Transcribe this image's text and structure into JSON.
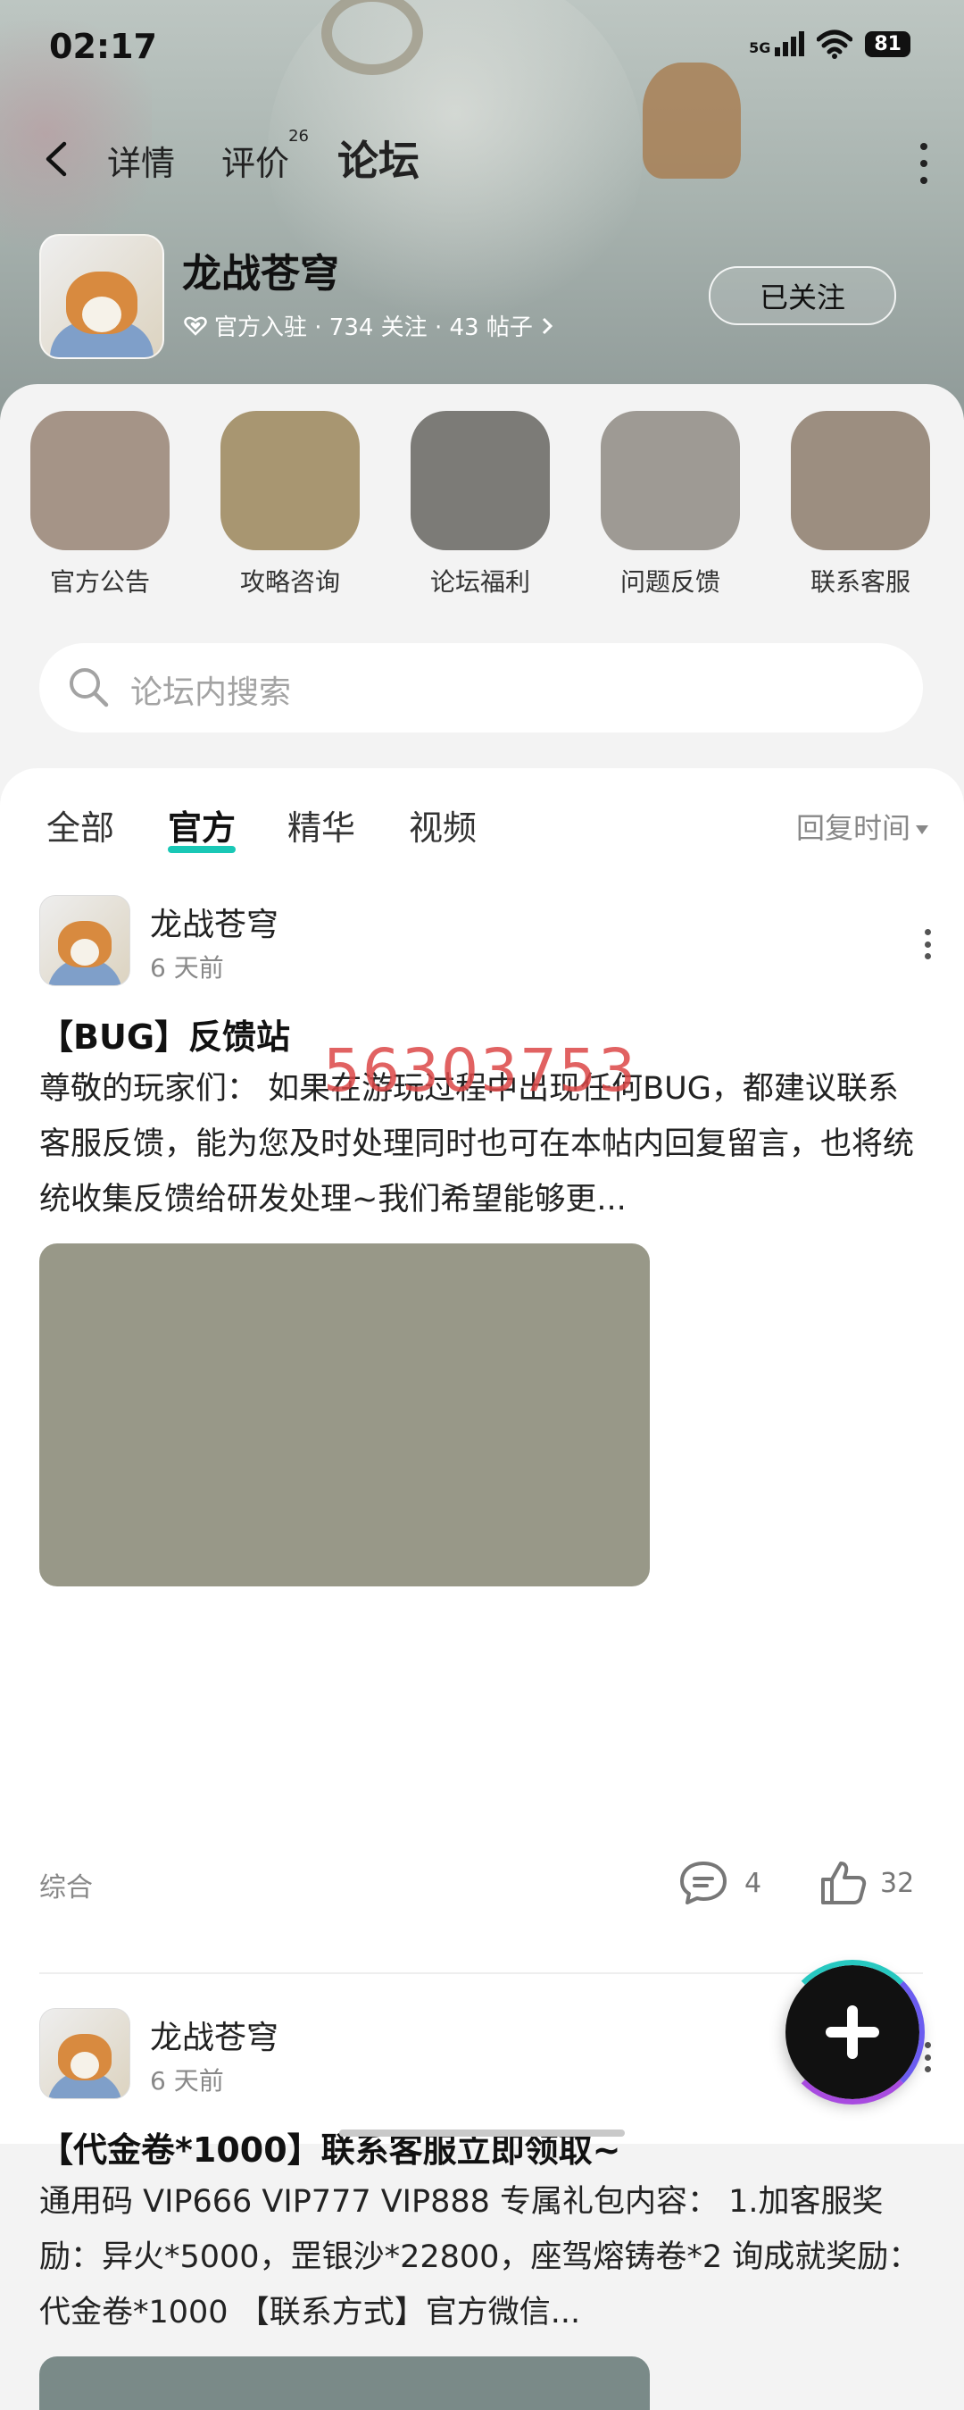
{
  "status_bar": {
    "time": "02:17",
    "network": "5G",
    "battery": "81"
  },
  "top_nav": {
    "tabs": [
      {
        "label": "详情"
      },
      {
        "label": "评价",
        "badge": "26"
      },
      {
        "label": "论坛",
        "active": true
      }
    ]
  },
  "game": {
    "name": "龙战苍穹",
    "meta": "官方入驻 · 734 关注 · 43 帖子",
    "follow_label": "已关注"
  },
  "shortcuts": [
    {
      "label": "官方公告",
      "color": "#a59487"
    },
    {
      "label": "攻略咨询",
      "color": "#a89671"
    },
    {
      "label": "论坛福利",
      "color": "#7c7b77"
    },
    {
      "label": "问题反馈",
      "color": "#9e9a94"
    },
    {
      "label": "联系客服",
      "color": "#9c8e80"
    }
  ],
  "search": {
    "placeholder": "论坛内搜索"
  },
  "feed_tabs": {
    "tabs": [
      "全部",
      "官方",
      "精华",
      "视频"
    ],
    "active": "官方",
    "sort_label": "回复时间"
  },
  "posts": [
    {
      "author": "龙战苍穹",
      "time": "6 天前",
      "title": "【BUG】反馈站",
      "body": "尊敬的玩家们：   如果在游玩过程中出现任何BUG，都建议联系客服反馈，能为您及时处理同时也可在本帖内回复留言，也将统统收集反馈给研发处理~我们希望能够更...",
      "image_color": "#989888",
      "category": "综合",
      "comments": "4",
      "likes": "32"
    },
    {
      "author": "龙战苍穹",
      "time": "6 天前",
      "title": "【代金卷*1000】联系客服立即领取~",
      "body": "通用码 VIP666 VIP777 VIP888 专属礼包内容： 1.加客服奖励：异火*5000，罡银沙*22800，座驾熔铸卷*2 询成就奖励：代金卷*1000 【联系方式】官方微信...",
      "image_color": "#7a8a88"
    }
  ],
  "watermark": "56303753",
  "colors": {
    "accent": "#19c8b6"
  }
}
